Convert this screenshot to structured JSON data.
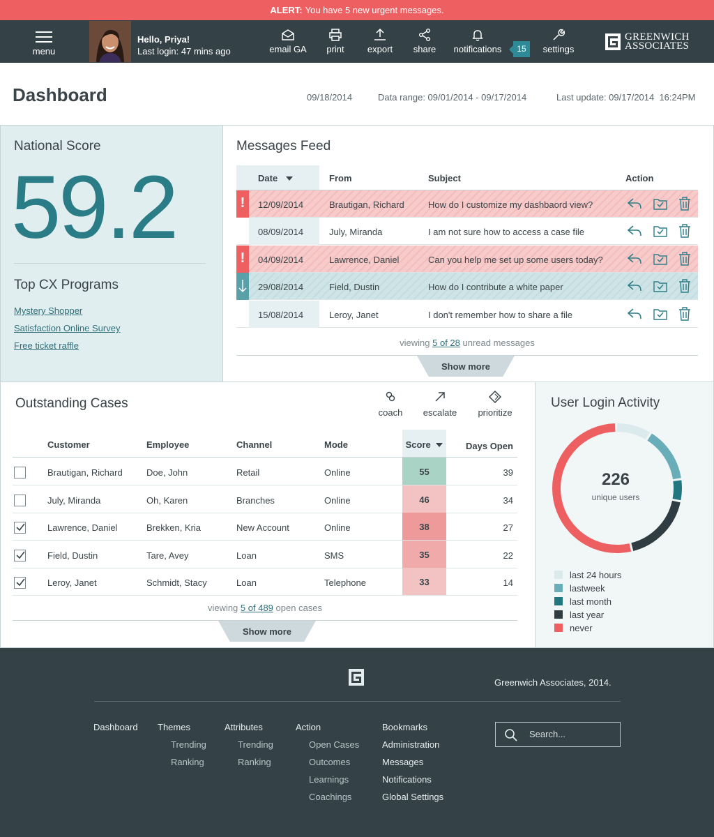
{
  "alert": {
    "prefix": "ALERT:",
    "message": "You have 5 new urgent messages."
  },
  "nav": {
    "menu_label": "menu",
    "greeting": "Hello, Priya!",
    "last_login": "Last login: 47 mins ago",
    "email_label": "email GA",
    "print_label": "print",
    "export_label": "export",
    "share_label": "share",
    "notifications_label": "notifications",
    "notifications_count": "15",
    "settings_label": "settings",
    "logo_line1": "GREENWICH",
    "logo_line2": "ASSOCIATES"
  },
  "dashboard": {
    "title": "Dashboard",
    "date": "09/18/2014",
    "data_range": "Data range: 09/01/2014 - 09/17/2014",
    "last_update": "Last update: 09/17/2014  16:24PM"
  },
  "national": {
    "title": "National Score",
    "score": "59.2",
    "programs_title": "Top CX Programs",
    "programs": [
      "Mystery Shopper",
      "Satisfaction Online Survey",
      "Free ticket raffle"
    ]
  },
  "messages": {
    "title": "Messages Feed",
    "headers": {
      "date": "Date",
      "from": "From",
      "subject": "Subject",
      "action": "Action"
    },
    "rows": [
      {
        "date": "12/09/2014",
        "from": "Brautigan, Richard",
        "subject": "How do I customize my dashbaord view?",
        "status": "urgent"
      },
      {
        "date": "08/09/2014",
        "from": "July, Miranda",
        "subject": "I am not sure how to access a case file",
        "status": "normal"
      },
      {
        "date": "04/09/2014",
        "from": "Lawrence, Daniel",
        "subject": "Can you help me set up some users today?",
        "status": "urgent"
      },
      {
        "date": "29/08/2014",
        "from": "Field, Dustin",
        "subject": "How do I contribute a white paper",
        "status": "down"
      },
      {
        "date": "15/08/2014",
        "from": "Leroy, Janet",
        "subject": "I don't remember how to share a file",
        "status": "normal"
      }
    ],
    "viewing_prefix": "viewing",
    "viewing_count": "5 of 28",
    "viewing_suffix": "unread messages",
    "show_more": "Show more"
  },
  "cases": {
    "title": "Outstanding Cases",
    "tools": {
      "coach": "coach",
      "escalate": "escalate",
      "prioritize": "prioritize"
    },
    "headers": {
      "customer": "Customer",
      "employee": "Employee",
      "channel": "Channel",
      "mode": "Mode",
      "score": "Score",
      "days_open": "Days Open"
    },
    "rows": [
      {
        "checked": false,
        "customer": "Brautigan, Richard",
        "employee": "Doe, John",
        "channel": "Retail",
        "mode": "Online",
        "score": "55",
        "days_open": "39",
        "score_color": "#a9d3c4"
      },
      {
        "checked": false,
        "customer": "July, Miranda",
        "employee": "Oh, Karen",
        "channel": "Branches",
        "mode": "Online",
        "score": "46",
        "days_open": "34",
        "score_color": "#f3c3c3"
      },
      {
        "checked": true,
        "customer": "Lawrence, Daniel",
        "employee": "Brekken, Kria",
        "channel": "New Account",
        "mode": "Online",
        "score": "38",
        "days_open": "27",
        "score_color": "#ee9a9a"
      },
      {
        "checked": true,
        "customer": "Field, Dustin",
        "employee": "Tare, Avey",
        "channel": "Loan",
        "mode": "SMS",
        "score": "35",
        "days_open": "22",
        "score_color": "#f1aaaa"
      },
      {
        "checked": true,
        "customer": "Leroy, Janet",
        "employee": "Schmidt, Stacy",
        "channel": "Loan",
        "mode": "Telephone",
        "score": "33",
        "days_open": "14",
        "score_color": "#f3c3c3"
      }
    ],
    "viewing_prefix": "viewing",
    "viewing_count": "5 of 489",
    "viewing_suffix": "open cases",
    "show_more": "Show more"
  },
  "login_activity": {
    "title": "User Login Activity",
    "total": "226",
    "total_label": "unique users",
    "segments": [
      {
        "label": "last 24 hours",
        "color": "#dbeaec",
        "fraction": 0.09
      },
      {
        "label": "lastweek",
        "color": "#69adb8",
        "fraction": 0.14
      },
      {
        "label": "last month",
        "color": "#22767f",
        "fraction": 0.055
      },
      {
        "label": "last year",
        "color": "#2f3c41",
        "fraction": 0.18
      },
      {
        "label": "never",
        "color": "#ee5f62",
        "fraction": 0.535
      }
    ]
  },
  "footer": {
    "copyright": "Greenwich Associates, 2014.",
    "columns": [
      {
        "title": "Dashboard",
        "items": []
      },
      {
        "title": "Themes",
        "items": [
          "Trending",
          "Ranking"
        ]
      },
      {
        "title": "Attributes",
        "items": [
          "Trending",
          "Ranking"
        ]
      },
      {
        "title": "Action",
        "items": [
          "Open Cases",
          "Outcomes",
          "Learnings",
          "Coachings"
        ]
      },
      {
        "title": "Bookmarks",
        "items": [
          "Administration",
          "Messages",
          "Notifications",
          "Global Settings"
        ]
      }
    ],
    "search_placeholder": "Search..."
  },
  "colors": {
    "alert": "#ee5f62",
    "nav": "#344247",
    "accent": "#2a7c87",
    "panel_tint": "#e1eef0"
  }
}
